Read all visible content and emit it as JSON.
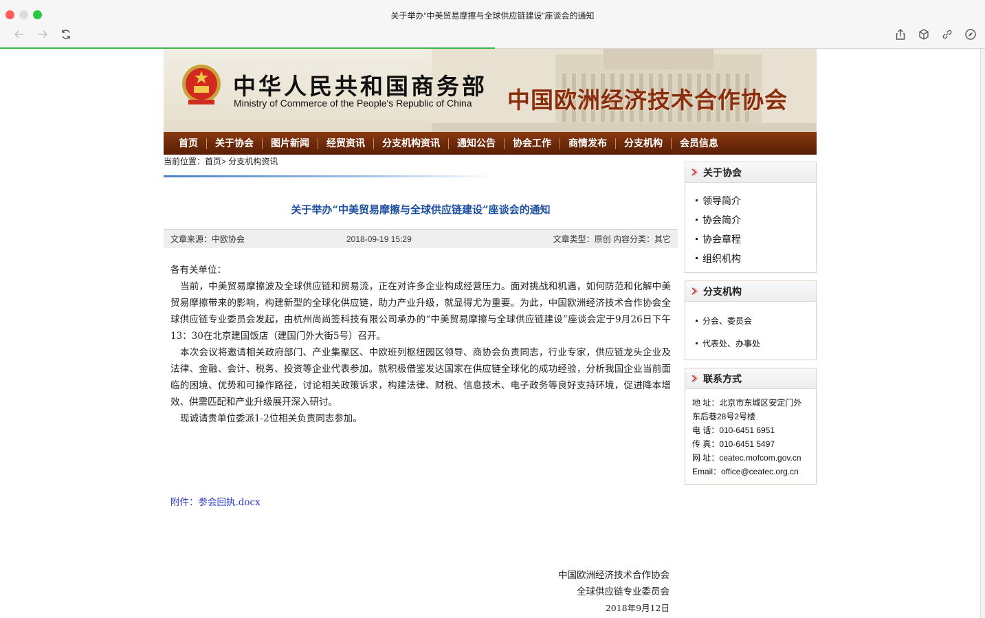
{
  "window": {
    "title": "关于举办“中美贸易摩擦与全球供应链建设”座谈会的通知"
  },
  "toolbar": {
    "back_icon": "arrow-left-icon",
    "forward_icon": "arrow-right-icon",
    "reload_icon": "reload-icon",
    "share_icon": "share-icon",
    "box_icon": "cube-icon",
    "link_icon": "link-icon",
    "compass_icon": "compass-icon"
  },
  "header": {
    "ministry_cn": "中华人民共和国商务部",
    "ministry_en": "Ministry of Commerce of the People's Republic of China",
    "association_name": "中国欧洲经济技术合作协会"
  },
  "nav": {
    "items": [
      "首页",
      "关于协会",
      "图片新闻",
      "经贸资讯",
      "分支机构资讯",
      "通知公告",
      "协会工作",
      "商情发布",
      "分支机构",
      "会员信息"
    ]
  },
  "breadcrumb": {
    "label": "当前位置：",
    "path": "首页> 分支机构资讯"
  },
  "article": {
    "title": "关于举办“中美贸易摩擦与全球供应链建设”座谈会的通知",
    "source": "文章来源：中欧协会",
    "date": "2018-09-19 15:29",
    "type": "文章类型：原创 内容分类：其它",
    "salutation": "各有关单位：",
    "paragraphs": [
      "当前，中美贸易摩擦波及全球供应链和贸易流，正在对许多企业构成经营压力。面对挑战和机遇，如何防范和化解中美贸易摩擦带来的影响，构建新型的全球化供应链，助力产业升级，就显得尤为重要。为此，中国欧洲经济技术合作协会全球供应链专业委员会发起，由杭州尚尚签科技有限公司承办的“中美贸易摩擦与全球供应链建设”座谈会定于9月26日下午13：30在北京建国饭店（建国门外大街5号）召开。",
      "本次会议将邀请相关政府部门、产业集聚区、中欧班列枢纽园区领导、商协会负责同志，行业专家，供应链龙头企业及法律、金融、会计、税务、投资等企业代表参加。就积极借鉴发达国家在供应链全球化的成功经验，分析我国企业当前面临的困境、优势和可操作路径，讨论相关政策诉求，构建法律、财税、信息技术、电子政务等良好支持环境，促进降本增效、供需匹配和产业升级展开深入研讨。",
      "现诚请贵单位委派1-2位相关负责同志参加。"
    ],
    "attachment": "附件：参会回执.docx",
    "signature": [
      "中国欧洲经济技术合作协会",
      "全球供应链专业委员会"
    ],
    "sign_date": "2018年9月12日"
  },
  "sidebar": {
    "about": {
      "title": "关于协会",
      "items": [
        "领导简介",
        "协会简介",
        "协会章程",
        "组织机构"
      ]
    },
    "branches": {
      "title": "分支机构",
      "items": [
        "分会、委员会",
        "代表处、办事处"
      ]
    },
    "contact": {
      "title": "联系方式",
      "lines": [
        "地 址：北京市东城区安定门外",
        "东后巷28号2号楼",
        "电 话：010-6451 6951",
        "传 真：010-6451 5497",
        "网 址：ceatec.mofcom.gov.cn",
        "Email：office@ceatec.org.cn"
      ]
    }
  },
  "colors": {
    "nav_bg": "#6d2909",
    "title_blue": "#1d4fa0",
    "link_blue": "#2a3ac8",
    "association_red": "#8a2c0e",
    "progress_green": "#3bb54a"
  }
}
